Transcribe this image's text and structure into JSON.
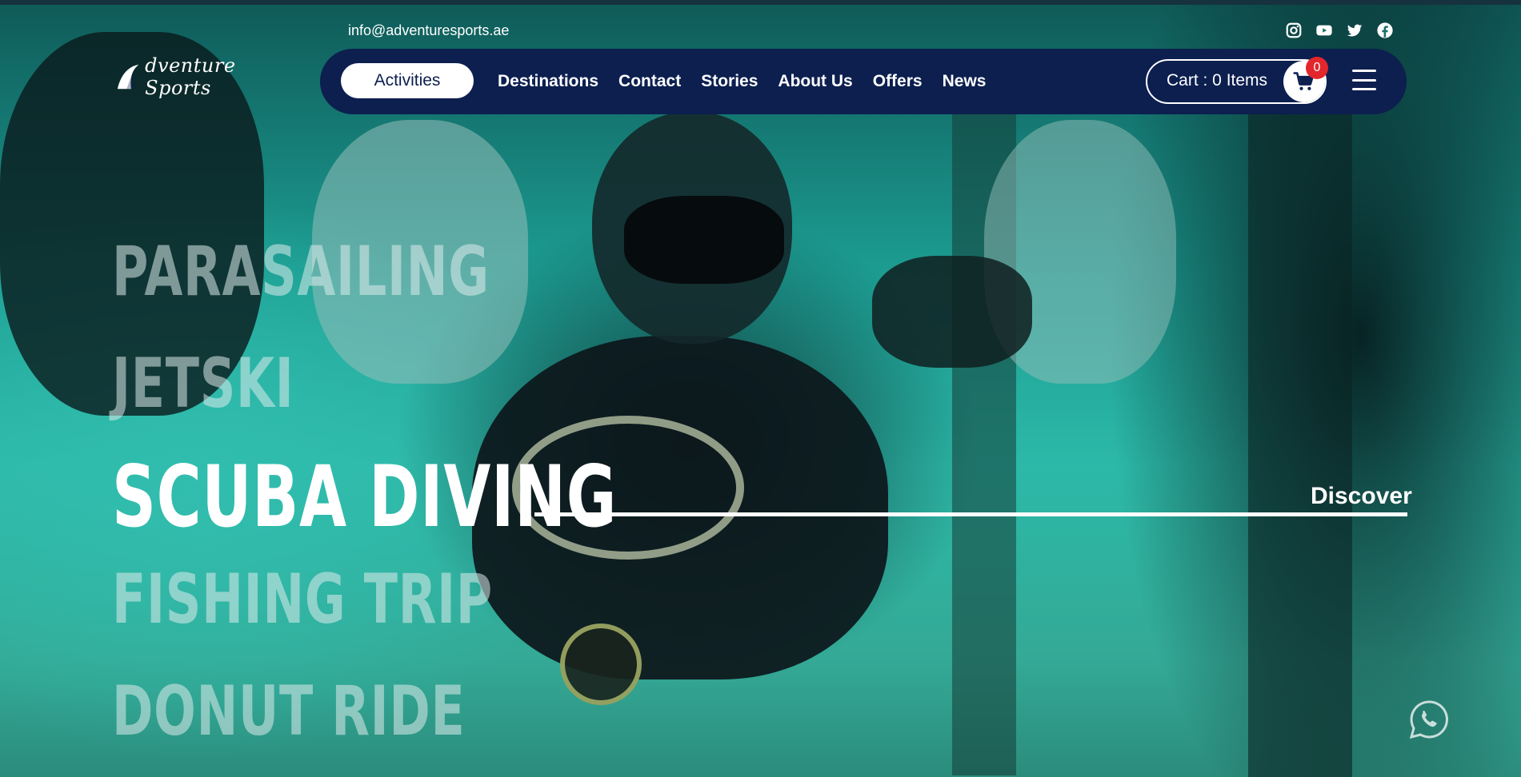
{
  "header": {
    "email": "info@adventuresports.ae",
    "socials": [
      {
        "name": "instagram-icon"
      },
      {
        "name": "youtube-icon"
      },
      {
        "name": "twitter-icon"
      },
      {
        "name": "facebook-icon"
      }
    ]
  },
  "logo": {
    "mark": "A",
    "text": "dventure Sports"
  },
  "nav": {
    "active": "Activities",
    "links": [
      "Destinations",
      "Contact",
      "Stories",
      "About Us",
      "Offers",
      "News"
    ],
    "cart_label": "Cart : 0 Items",
    "cart_count": "0"
  },
  "hero": {
    "activities": [
      {
        "label": "PARASAILING",
        "active": false
      },
      {
        "label": "JETSKI",
        "active": false
      },
      {
        "label": "SCUBA DIVING",
        "active": true
      },
      {
        "label": "FISHING TRIP",
        "active": false
      },
      {
        "label": "DONUT RIDE",
        "active": false
      }
    ],
    "discover": "Discover"
  },
  "colors": {
    "nav_bg": "#0c1f4f",
    "badge": "#e3262b",
    "water": "#2cb9a8"
  }
}
